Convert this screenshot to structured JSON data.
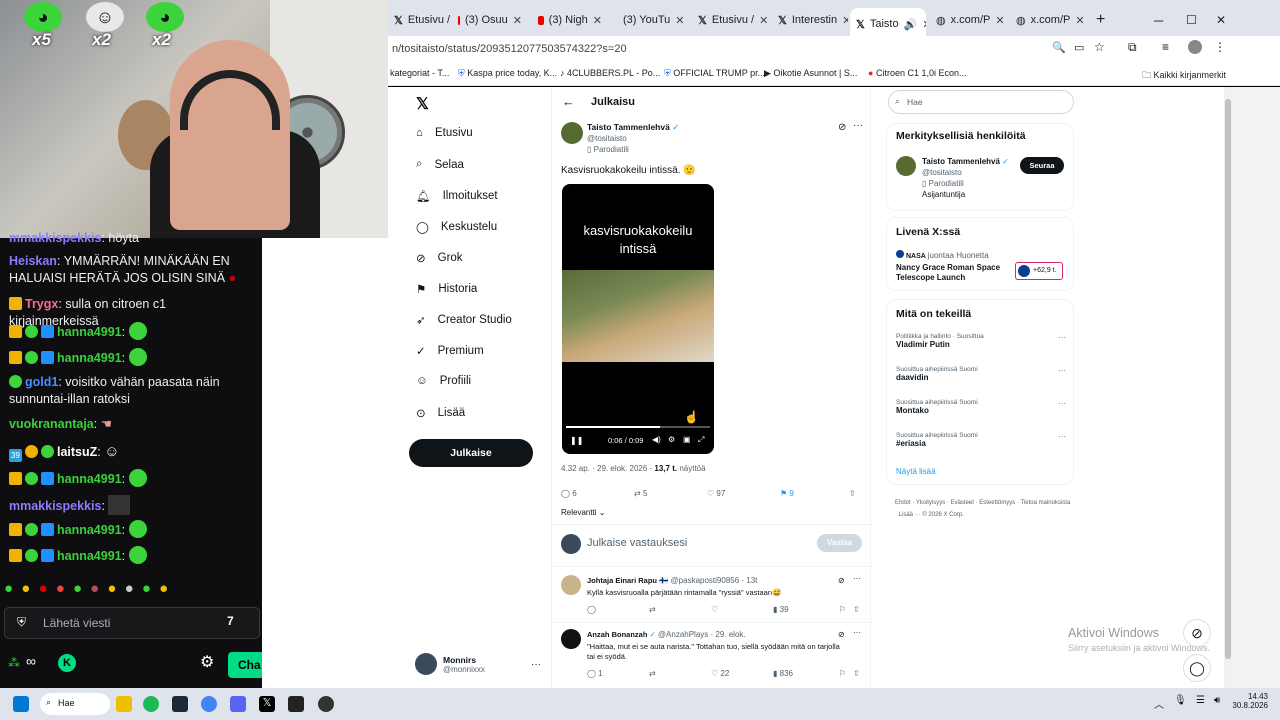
{
  "tabs": [
    {
      "label": "Etusivu /",
      "icon": "x-icon"
    },
    {
      "label": "(3) Osuu",
      "icon": "youtube-icon"
    },
    {
      "label": "(3) Nigh",
      "icon": "youtube-icon"
    },
    {
      "label": "(3) YouTu",
      "icon": "youtube-icon"
    },
    {
      "label": "Etusivu /",
      "icon": "x-icon"
    },
    {
      "label": "Interestin",
      "icon": "x-icon"
    },
    {
      "label": "Taisto",
      "icon": "x-icon"
    },
    {
      "label": "x.com/P",
      "icon": "globe-icon"
    },
    {
      "label": "x.com/P",
      "icon": "globe-icon"
    }
  ],
  "browser": {
    "url": "n/tositaisto/status/2093512077503574322?s=20",
    "new_tab": "+"
  },
  "bookmarks": [
    "kategoriat - T...",
    "Kaspa price today, K...",
    "4CLUBBERS.PL - Po...",
    "OFFICIAL TRUMP pr...",
    "Oikotie Asunnot | S...",
    "Citroen C1 1,0i Econ...",
    "Kaikki kirjanmerkit"
  ],
  "stream": {
    "multipliers": [
      "x5",
      "x2",
      "x2"
    ]
  },
  "chat": {
    "messages": [
      {
        "user": "mmakkispekkis",
        "text": "höyta"
      },
      {
        "user": "Heiskan",
        "text": "YMMÄRRÄN! MINÄKÄÄN EN HALUAISI HERÄTÄ JOS OLISIN SINÄ"
      },
      {
        "user": "Trygx",
        "text": "sulla on citroen c1 kirjainmerkeissä"
      },
      {
        "user": "hanna4991",
        "text": ""
      },
      {
        "user": "hanna4991",
        "text": ""
      },
      {
        "user": "gold1",
        "text": "voisitko vähän paasata näin sunnuntai-illan ratoksi"
      },
      {
        "user": "vuokranantaja",
        "text": ""
      },
      {
        "user": "laitsuZ",
        "text": ""
      },
      {
        "user": "hanna4991",
        "text": ""
      },
      {
        "user": "mmakkispekkis",
        "text": ""
      },
      {
        "user": "hanna4991",
        "text": ""
      },
      {
        "user": "hanna4991",
        "text": ""
      }
    ],
    "sub_count": "39",
    "input_placeholder": "Lähetä viesti",
    "chat_button": "Cha"
  },
  "x": {
    "nav": [
      "Etusivu",
      "Selaa",
      "Ilmoitukset",
      "Keskustelu",
      "Grok",
      "Historia",
      "Creator Studio",
      "Premium",
      "Profiili",
      "Lisää"
    ],
    "post_button": "Julkaise",
    "account": {
      "name": "Monnirs",
      "handle": "@monnixxx"
    },
    "header": "Julkaisu",
    "post": {
      "author": "Taisto Tammenlehvä",
      "handle": "@tositaisto",
      "label": "Parodiatili",
      "text": "Kasvisruokakokeilu intissä. 🫡",
      "video_caption": "kasvisruokakokeilu intissä",
      "video_time": "0:06 / 0:09",
      "meta": "4.32 ap. · 29. elok. 2026 · ",
      "views": "13,7 t.",
      "views_label": "näyttöä",
      "stats": {
        "replies": "6",
        "reposts": "5",
        "likes": "97",
        "bookmarks": "9"
      },
      "sort": "Relevantti"
    },
    "reply_box": {
      "placeholder": "Julkaise vastauksesi",
      "button": "Vastaa"
    },
    "replies": [
      {
        "name": "Johtaja Einari Rapu 🇫🇮",
        "handle": "@paskaposti90856 · 13t",
        "text": "Kyllä kasvisruoalla pärjätään rintamalla \"ryssiä\" vastaan😅",
        "views": "39",
        "comments": "",
        "likes": ""
      },
      {
        "name": "Anzah Bonanzah",
        "handle": "@AnzahPlays · 29. elok.",
        "text": "\"Haittaa, mut ei se auta narista.\" Tottahan tuo, siellä syödään mitä on tarjolla tai ei syödä.",
        "comments": "1",
        "likes": "22",
        "views": "836"
      }
    ],
    "search_placeholder": "Hae",
    "people": {
      "title": "Merkityksellisiä henkilöitä",
      "name": "Taisto Tammenlehvä",
      "handle": "@tositaisto",
      "label": "Parodiatili",
      "bio": "Asijantuntija",
      "follow": "Seuraa"
    },
    "live": {
      "title": "Livenä X:ssä",
      "host": "NASA",
      "host_meta": "juontaa Huonetta",
      "event": "Nancy Grace Roman Space Telescope Launch",
      "count": "+62,9 t."
    },
    "trends": {
      "title": "Mitä on tekeillä",
      "items": [
        {
          "context": "Politiikka ja hallinto · Suosittua",
          "name": "Vladimir Putin"
        },
        {
          "context": "Suosittua aihepiirissä Suomi",
          "name": "daavidin"
        },
        {
          "context": "Suosittua aihepiirissä Suomi",
          "name": "Montako"
        },
        {
          "context": "Suosittua aihepiirissä Suomi",
          "name": "#eriasia"
        }
      ],
      "more": "Näytä lisää"
    },
    "footer": "Ehdot · Yksityisyys · Evästeet · Esteettömyys · Tietoa mainoksista · Lisää ··· © 2026 X Corp."
  },
  "watermark": {
    "line1": "Aktivoi Windows",
    "line2": "Siirry asetuksiin ja aktivoi Windows."
  },
  "taskbar": {
    "search": "Hae",
    "time": "14.43",
    "date": "30.8.2026"
  }
}
